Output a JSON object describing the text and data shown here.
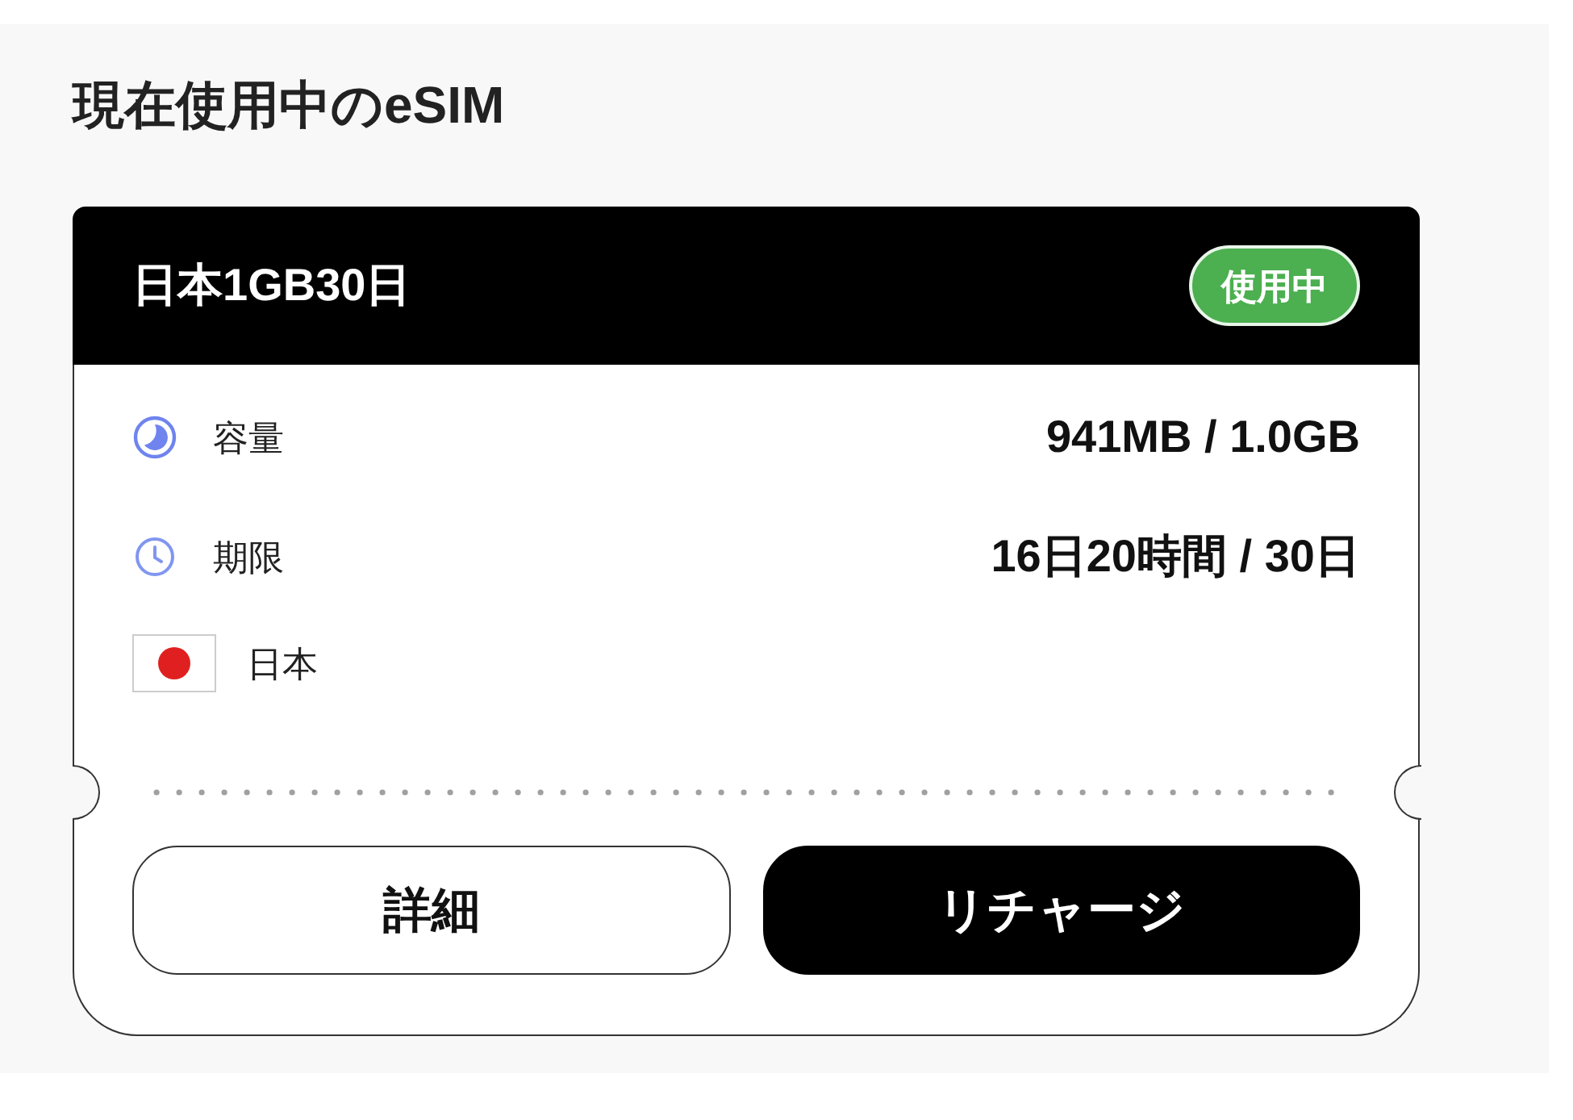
{
  "section": {
    "title": "現在使用中のeSIM"
  },
  "esim_card": {
    "plan_name": "日本1GB30日",
    "status_badge": "使用中",
    "details": [
      {
        "kind": "data",
        "label": "容量",
        "value": "941MB / 1.0GB"
      },
      {
        "kind": "validity",
        "label": "期限",
        "value": "16日20時間 / 30日"
      },
      {
        "kind": "country",
        "label": "日本"
      }
    ],
    "buttons": [
      {
        "kind": "outline",
        "label": "詳細"
      },
      {
        "kind": "filled",
        "label": "リチャージ"
      }
    ]
  }
}
